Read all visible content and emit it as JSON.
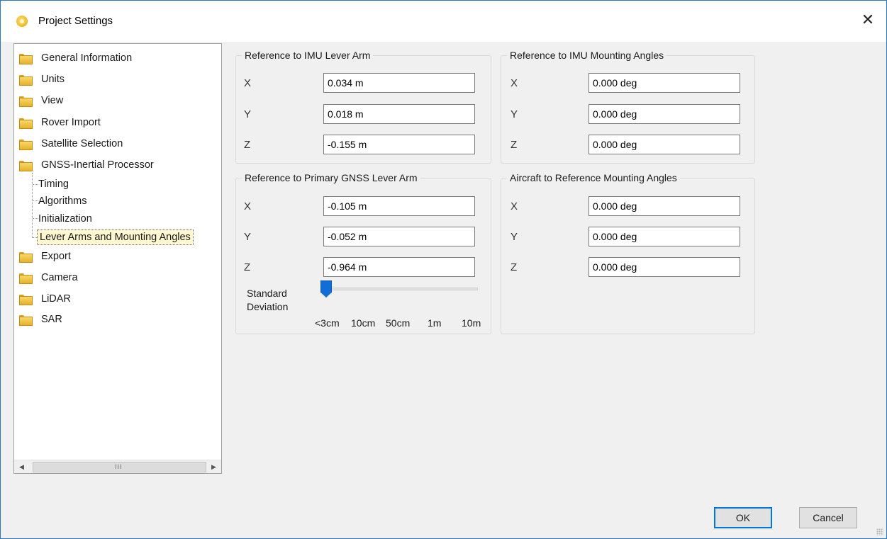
{
  "window": {
    "title": "Project Settings",
    "icon": "app-sun-icon",
    "close_glyph": "✕"
  },
  "tree": {
    "items": [
      {
        "label": "General Information",
        "type": "folder"
      },
      {
        "label": "Units",
        "type": "folder"
      },
      {
        "label": "View",
        "type": "folder"
      },
      {
        "label": "Rover Import",
        "type": "folder"
      },
      {
        "label": "Satellite Selection",
        "type": "folder"
      },
      {
        "label": "GNSS-Inertial Processor",
        "type": "folder",
        "expanded": true
      },
      {
        "label": "Timing",
        "type": "child"
      },
      {
        "label": "Algorithms",
        "type": "child"
      },
      {
        "label": "Initialization",
        "type": "child"
      },
      {
        "label": "Lever Arms and Mounting Angles",
        "type": "child",
        "selected": true
      },
      {
        "label": "Export",
        "type": "folder"
      },
      {
        "label": "Camera",
        "type": "folder"
      },
      {
        "label": "LiDAR",
        "type": "folder"
      },
      {
        "label": "SAR",
        "type": "folder"
      }
    ],
    "scroll_left": "◀",
    "scroll_right": "▶",
    "scroll_grip": "III"
  },
  "imu_lever_arm": {
    "title": "Reference to IMU Lever Arm",
    "x_label": "X",
    "x_value": "0.034 m",
    "y_label": "Y",
    "y_value": "0.018 m",
    "z_label": "Z",
    "z_value": "-0.155 m"
  },
  "imu_mounting_angles": {
    "title": "Reference to IMU Mounting Angles",
    "x_label": "X",
    "x_value": "0.000 deg",
    "y_label": "Y",
    "y_value": "0.000 deg",
    "z_label": "Z",
    "z_value": "0.000 deg"
  },
  "gnss_lever_arm": {
    "title": "Reference to Primary GNSS Lever Arm",
    "x_label": "X",
    "x_value": "-0.105 m",
    "y_label": "Y",
    "y_value": "-0.052 m",
    "z_label": "Z",
    "z_value": "-0.964 m",
    "std_dev_label_1": "Standard",
    "std_dev_label_2": "Deviation",
    "std_dev_ticks": [
      "<3cm",
      "10cm",
      "50cm",
      "1m",
      "10m"
    ],
    "std_dev_selected": "<3cm"
  },
  "aircraft_mounting_angles": {
    "title": "Aircraft to Reference Mounting Angles",
    "x_label": "X",
    "x_value": "0.000 deg",
    "y_label": "Y",
    "y_value": "0.000 deg",
    "z_label": "Z",
    "z_value": "0.000 deg"
  },
  "buttons": {
    "ok": "OK",
    "cancel": "Cancel"
  },
  "colors": {
    "accent": "#0078d7",
    "selection_bg": "#fff7cf",
    "folder": "#e6b22a"
  }
}
